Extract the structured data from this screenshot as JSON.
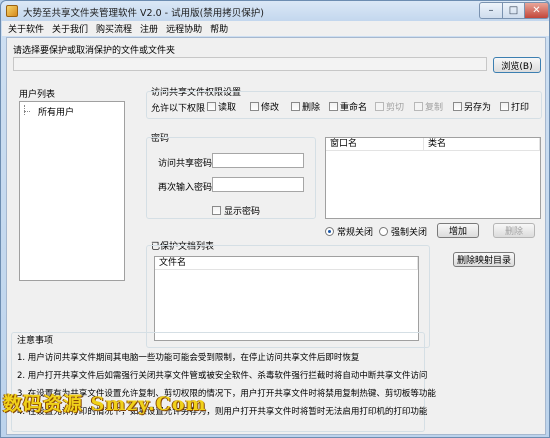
{
  "window": {
    "title": "大势至共享文件夹管理软件 V2.0 - 试用版(禁用拷贝保护)",
    "min_symbol": "–",
    "max_symbol": "□",
    "close_symbol": "✕"
  },
  "menu": {
    "items": [
      "关于软件",
      "关于我们",
      "购买流程",
      "注册",
      "远程协助",
      "帮助"
    ]
  },
  "folder_select": {
    "label": "请选择要保护或取消保护的文件或文件夹",
    "path_value": "",
    "browse_button": "浏览(B)"
  },
  "user_list": {
    "header": "用户列表",
    "items": [
      "所有用户"
    ]
  },
  "permissions": {
    "title": "访问共享文件权限设置",
    "allow_label": "允许以下权限",
    "options": [
      {
        "label": "读取",
        "checked": false,
        "enabled": true
      },
      {
        "label": "修改",
        "checked": false,
        "enabled": true
      },
      {
        "label": "删除",
        "checked": false,
        "enabled": true
      },
      {
        "label": "重命名",
        "checked": false,
        "enabled": true
      },
      {
        "label": "剪切",
        "checked": false,
        "enabled": false
      },
      {
        "label": "复制",
        "checked": false,
        "enabled": false
      },
      {
        "label": "另存为",
        "checked": false,
        "enabled": true
      },
      {
        "label": "打印",
        "checked": false,
        "enabled": true
      }
    ]
  },
  "password": {
    "title": "密码",
    "access_label": "访问共享密码",
    "access_value": "",
    "confirm_label": "再次输入密码",
    "confirm_value": "",
    "show_label": "显示密码",
    "show_checked": false
  },
  "window_list": {
    "columns": [
      "窗口名",
      "类名"
    ],
    "rows": []
  },
  "close_mode": {
    "normal_label": "常规关闭",
    "normal_selected": true,
    "force_label": "强制关闭",
    "force_selected": false,
    "add_button": "增加",
    "delete_button": "删除",
    "delete_mapping_button": "删除映射目录"
  },
  "protected_list": {
    "title": "已保护文档列表",
    "columns": [
      "文件名"
    ],
    "rows": []
  },
  "notes": {
    "title": "注意事项",
    "lines": [
      "1. 用户访问共享文件期间其电脑一些功能可能会受到限制，在停止访问共享文件后即时恢复",
      "2. 用户打开共享文件后如需强行关闭共享文件管或被安全软件、杀毒软件强行拦截时将自动中断共享文件访问",
      "3. 在设置有为共享文件设置允许复制、剪切权限的情况下，用户打开共享文件时将禁用复制热键、剪切板等功能",
      "4. 在设置允许打印的情况下，如果设置允许另存为，则用户打开共享文件时将暂时无法启用打印机的打印功能"
    ]
  },
  "watermark": {
    "text": "数码资源 Smzy.Com"
  }
}
